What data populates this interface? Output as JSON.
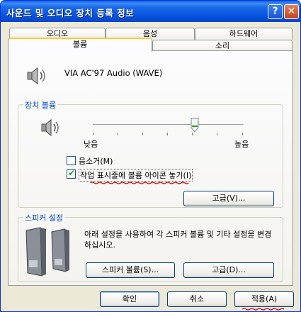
{
  "window": {
    "title": "사운드 및 오디오 장치 등록 정보"
  },
  "titlebar": {
    "help_label": "?",
    "close_label": "✕"
  },
  "tabs": {
    "row1": [
      "오디오",
      "음성",
      "하드웨어"
    ],
    "row2": [
      "볼륨",
      "소리"
    ],
    "active": "볼륨"
  },
  "device": {
    "name": "VIA AC'97 Audio (WAVE)"
  },
  "device_volume": {
    "group_title": "장치 볼륨",
    "low_label": "낮음",
    "high_label": "높음",
    "level_fraction": 0.68,
    "mute_label": "음소거(M)",
    "mute_checked": false,
    "tray_icon_label": "작업 표시줄에 볼륨 아이콘 놓기(I)",
    "tray_icon_checked": true,
    "advanced_button": "고급(V)..."
  },
  "speaker_settings": {
    "group_title": "스피커 설정",
    "description": "아래 설정을 사용하여 각 스피커 볼륨 및 기타 설정을 변경하십시오.",
    "speaker_volume_button": "스피커 볼륨(S)...",
    "advanced_button": "고급(D)..."
  },
  "footer": {
    "ok": "확인",
    "cancel": "취소",
    "apply": "적용(A)"
  },
  "colors": {
    "titlebar": "#0554E0",
    "group_title": "#0046D5",
    "annotation": "#E00000"
  }
}
